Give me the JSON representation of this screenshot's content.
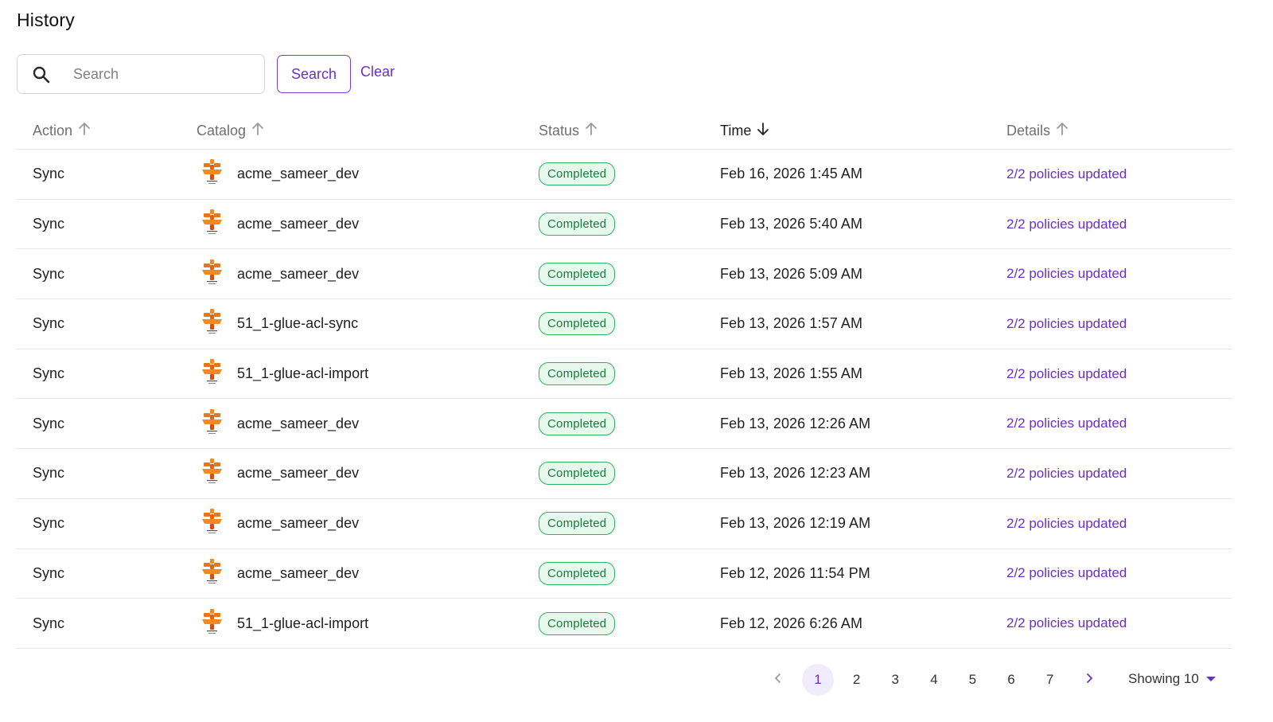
{
  "page": {
    "title": "History"
  },
  "search": {
    "placeholder": "Search",
    "value": "",
    "button_label": "Search",
    "clear_label": "Clear"
  },
  "table": {
    "columns": [
      {
        "label": "Action",
        "sort": "up",
        "active": false
      },
      {
        "label": "Catalog",
        "sort": "up",
        "active": false
      },
      {
        "label": "Status",
        "sort": "up",
        "active": false
      },
      {
        "label": "Time",
        "sort": "down",
        "active": true
      },
      {
        "label": "Details",
        "sort": "up",
        "active": false
      }
    ],
    "rows": [
      {
        "action": "Sync",
        "catalog": "acme_sameer_dev",
        "status": "Completed",
        "time": "Feb 16, 2026 1:45 AM",
        "details": "2/2 policies updated"
      },
      {
        "action": "Sync",
        "catalog": "acme_sameer_dev",
        "status": "Completed",
        "time": "Feb 13, 2026 5:40 AM",
        "details": "2/2 policies updated"
      },
      {
        "action": "Sync",
        "catalog": "acme_sameer_dev",
        "status": "Completed",
        "time": "Feb 13, 2026 5:09 AM",
        "details": "2/2 policies updated"
      },
      {
        "action": "Sync",
        "catalog": "51_1-glue-acl-sync",
        "status": "Completed",
        "time": "Feb 13, 2026 1:57 AM",
        "details": "2/2 policies updated"
      },
      {
        "action": "Sync",
        "catalog": "51_1-glue-acl-import",
        "status": "Completed",
        "time": "Feb 13, 2026 1:55 AM",
        "details": "2/2 policies updated"
      },
      {
        "action": "Sync",
        "catalog": "acme_sameer_dev",
        "status": "Completed",
        "time": "Feb 13, 2026 12:26 AM",
        "details": "2/2 policies updated"
      },
      {
        "action": "Sync",
        "catalog": "acme_sameer_dev",
        "status": "Completed",
        "time": "Feb 13, 2026 12:23 AM",
        "details": "2/2 policies updated"
      },
      {
        "action": "Sync",
        "catalog": "acme_sameer_dev",
        "status": "Completed",
        "time": "Feb 13, 2026 12:19 AM",
        "details": "2/2 policies updated"
      },
      {
        "action": "Sync",
        "catalog": "acme_sameer_dev",
        "status": "Completed",
        "time": "Feb 12, 2026 11:54 PM",
        "details": "2/2 policies updated"
      },
      {
        "action": "Sync",
        "catalog": "51_1-glue-acl-import",
        "status": "Completed",
        "time": "Feb 12, 2026 6:26 AM",
        "details": "2/2 policies updated"
      }
    ]
  },
  "catalog_icon": "aws-glue-icon",
  "pagination": {
    "pages": [
      "1",
      "2",
      "3",
      "4",
      "5",
      "6",
      "7"
    ],
    "current": "1",
    "prev_icon": "chevron-left-icon",
    "next_icon": "chevron-right-icon",
    "page_size_label": "Showing 10"
  },
  "colors": {
    "accent": "#6b2fc6",
    "success_border": "#2bb55f",
    "success_bg": "#e7f8ec",
    "success_text": "#197a3d",
    "glue_orange": "#e8761a"
  }
}
